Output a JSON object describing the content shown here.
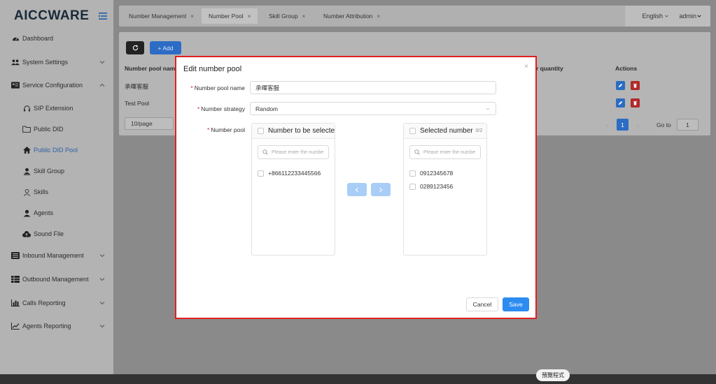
{
  "app": {
    "logo": "AICCWARE"
  },
  "sidebar": {
    "items": [
      {
        "label": "Dashboard",
        "icon": "dashboard-icon"
      },
      {
        "label": "System Settings",
        "icon": "users-icon"
      },
      {
        "label": "Service Configuration",
        "icon": "list-card-icon"
      },
      {
        "label": "SIP Extension",
        "icon": "headset-icon"
      },
      {
        "label": "Public DID",
        "icon": "folder-icon"
      },
      {
        "label": "Public DID Pool",
        "icon": "home-icon"
      },
      {
        "label": "Skill Group",
        "icon": "user-group-icon"
      },
      {
        "label": "Skills",
        "icon": "user-outline-icon"
      },
      {
        "label": "Agents",
        "icon": "user-icon"
      },
      {
        "label": "Sound File",
        "icon": "cloud-upload-icon"
      },
      {
        "label": "Inbound Management",
        "icon": "inbound-icon"
      },
      {
        "label": "Outbound Management",
        "icon": "table-icon"
      },
      {
        "label": "Calls Reporting",
        "icon": "bar-chart-icon"
      },
      {
        "label": "Agents Reporting",
        "icon": "line-chart-icon"
      }
    ]
  },
  "tabs": [
    {
      "label": "Number Management"
    },
    {
      "label": "Number Pool"
    },
    {
      "label": "Skill Group"
    },
    {
      "label": "Number Attribution"
    }
  ],
  "header": {
    "language": "English",
    "user": "admin"
  },
  "toolbar": {
    "add_label": "+ Add"
  },
  "table": {
    "col_name": "Number pool name",
    "col_quantity": "r quantity",
    "col_actions": "Actions",
    "rows": [
      {
        "name": "承暉客服"
      },
      {
        "name": "Test Pool"
      }
    ]
  },
  "pager": {
    "page_size": "10/page",
    "current_page": "1",
    "goto_label": "Go to",
    "goto_value": "1"
  },
  "modal": {
    "title": "Edit number pool",
    "name_label": "Number pool name",
    "name_value": "承暉客服",
    "strategy_label": "Number strategy",
    "strategy_value": "Random",
    "pool_label": "Number pool",
    "left_title": "Number to be selected",
    "left_search_placeholder": "Please enter the numbe",
    "left_items": [
      "+866112233445566"
    ],
    "right_title": "Selected number",
    "right_count": "0/2",
    "right_search_placeholder": "Please enter the numbe",
    "right_items": [
      "0912345678",
      "0289123456"
    ],
    "cancel_label": "Cancel",
    "save_label": "Save"
  },
  "taskbar": {
    "preview_label": "預覽程式"
  },
  "colors": {
    "primary": "#2d8cf0",
    "highlight_border": "#e02020",
    "delete": "#b02a2a"
  }
}
